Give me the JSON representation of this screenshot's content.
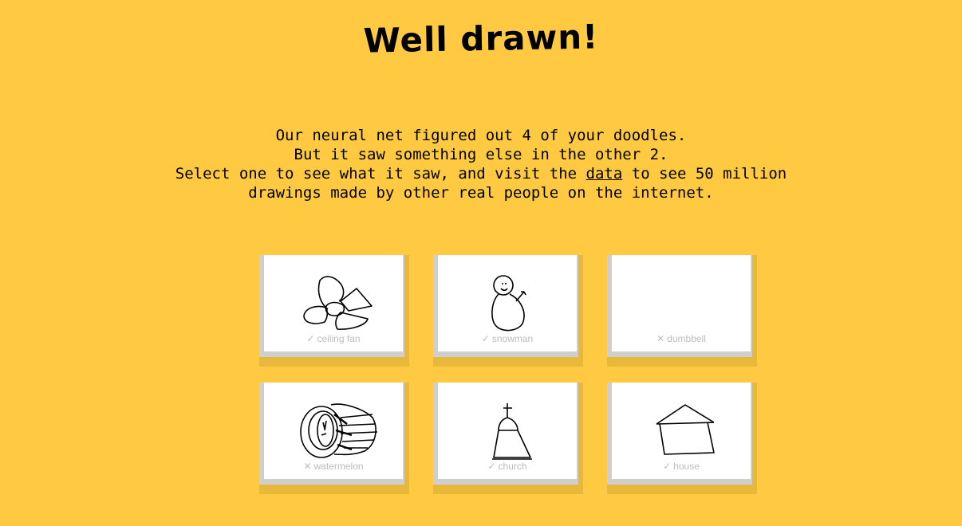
{
  "header": {
    "title": "Well drawn!"
  },
  "message": {
    "line1": "Our neural net figured out 4 of your doodles.",
    "line2": "But it saw something else in the other 2.",
    "line3_pre": "Select one to see what it saw, and visit the ",
    "line3_link": "data",
    "line3_post": " to see 50 million",
    "line4": "drawings made by other real people on the internet."
  },
  "doodles": [
    {
      "name": "ceiling fan",
      "mark": "✓",
      "recognized": true,
      "icon": "ceiling-fan-doodle"
    },
    {
      "name": "snowman",
      "mark": "✓",
      "recognized": true,
      "icon": "snowman-doodle"
    },
    {
      "name": "dumbbell",
      "mark": "✕",
      "recognized": false,
      "icon": "blank-doodle"
    },
    {
      "name": "watermelon",
      "mark": "✕",
      "recognized": false,
      "icon": "watermelon-doodle"
    },
    {
      "name": "church",
      "mark": "✓",
      "recognized": true,
      "icon": "church-doodle"
    },
    {
      "name": "house",
      "mark": "✓",
      "recognized": true,
      "icon": "house-doodle"
    }
  ],
  "colors": {
    "background": "#FFCA42",
    "card": "#FFFFFF",
    "label": "#BDBDBD"
  }
}
